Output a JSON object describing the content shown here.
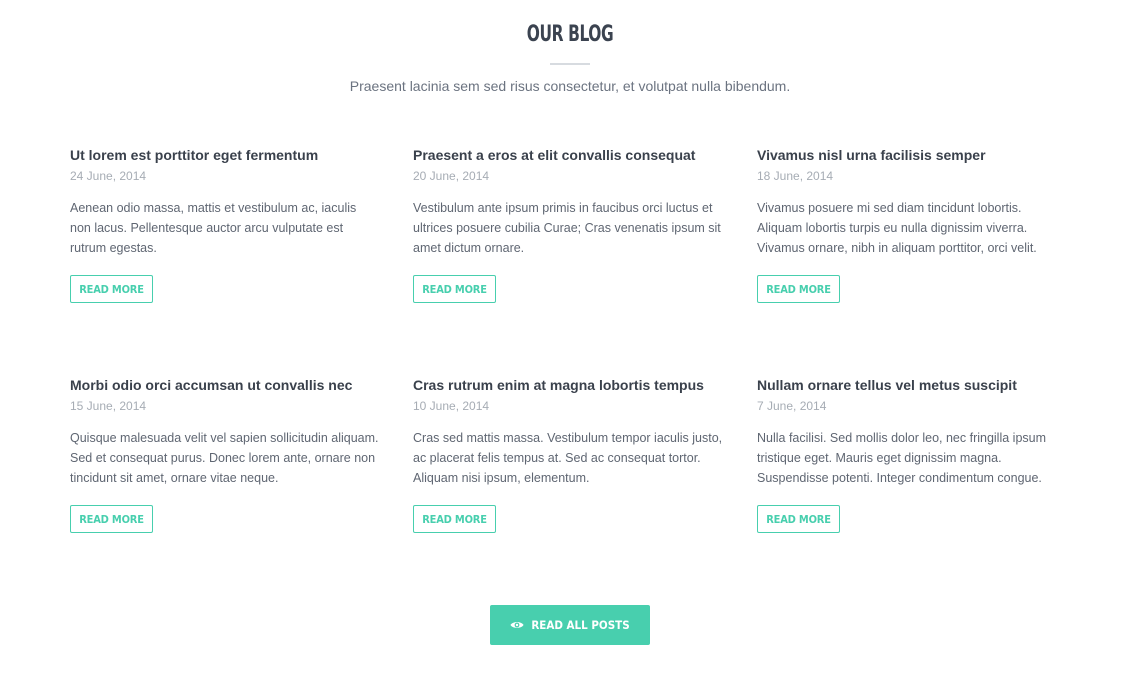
{
  "header": {
    "title": "OUR BLOG",
    "subtitle": "Praesent lacinia sem sed risus consectetur, et volutpat nulla bibendum."
  },
  "posts": [
    {
      "title": "Ut lorem est porttitor eget fermentum",
      "date": "24 June, 2014",
      "excerpt": "Aenean odio massa, mattis et vestibulum ac, iaculis non lacus. Pellentesque auctor arcu vulputate est rutrum egestas.",
      "button": "READ MORE"
    },
    {
      "title": "Praesent a eros at elit convallis consequat",
      "date": "20 June, 2014",
      "excerpt": "Vestibulum ante ipsum primis in faucibus orci luctus et ultrices posuere cubilia Curae; Cras venenatis ipsum sit amet dictum ornare.",
      "button": "READ MORE"
    },
    {
      "title": "Vivamus nisl urna facilisis semper",
      "date": "18 June, 2014",
      "excerpt": "Vivamus posuere mi sed diam tincidunt lobortis. Aliquam lobortis turpis eu nulla dignissim viverra. Vivamus ornare, nibh in aliquam porttitor, orci velit.",
      "button": "READ MORE"
    },
    {
      "title": "Morbi odio orci accumsan ut convallis nec",
      "date": "15 June, 2014",
      "excerpt": "Quisque malesuada velit vel sapien sollicitudin aliquam. Sed et consequat purus. Donec lorem ante, ornare non tincidunt sit amet, ornare vitae neque.",
      "button": "READ MORE"
    },
    {
      "title": "Cras rutrum enim at magna lobortis tempus",
      "date": "10 June, 2014",
      "excerpt": "Cras sed mattis massa. Vestibulum tempor iaculis justo, ac placerat felis tempus at. Sed ac consequat tortor. Aliquam nisi ipsum, elementum.",
      "button": "READ MORE"
    },
    {
      "title": "Nullam ornare tellus vel metus suscipit",
      "date": "7 June, 2014",
      "excerpt": "Nulla facilisi. Sed mollis dolor leo, nec fringilla ipsum tristique eget. Mauris eget dignissim magna. Suspendisse potenti. Integer condimentum congue.",
      "button": "READ MORE"
    }
  ],
  "footer": {
    "read_all_label": "READ ALL POSTS",
    "read_all_icon": "eye-icon"
  },
  "colors": {
    "accent": "#48cfae",
    "heading": "#3b4350",
    "text": "#5f6672",
    "date": "#a6acb4"
  }
}
